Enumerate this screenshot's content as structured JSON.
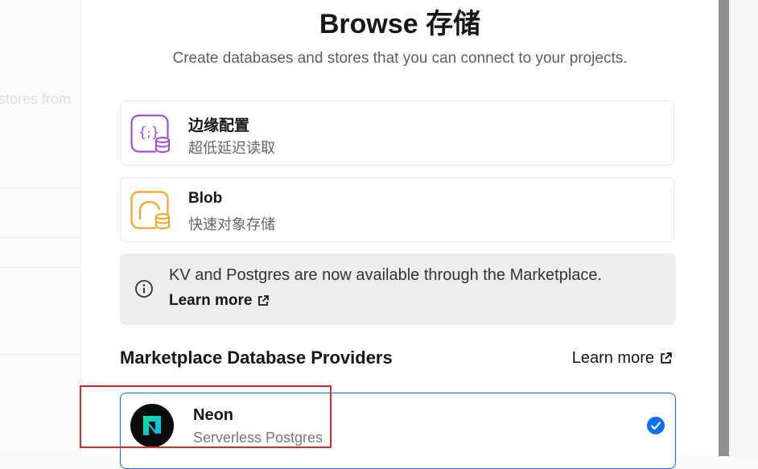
{
  "background": {
    "partial_text": "stores from"
  },
  "modal": {
    "title": "Browse 存储",
    "subtitle": "Create databases and stores that you can connect to your projects."
  },
  "stores": [
    {
      "name": "边缘配置",
      "description": "超低延迟读取",
      "icon": "edge-config-icon",
      "color": "#9b4fd6"
    },
    {
      "name": "Blob",
      "description": "快速对象存储",
      "icon": "blob-icon",
      "color": "#f5a524"
    }
  ],
  "notice": {
    "message": "KV and Postgres are now available through the Marketplace.",
    "link_label": "Learn more",
    "icon": "info-icon"
  },
  "marketplace": {
    "heading": "Marketplace Database Providers",
    "learn_more_label": "Learn more",
    "providers": [
      {
        "name": "Neon",
        "description": "Serverless Postgres",
        "selected": true,
        "icon": "neon-logo",
        "accent": "#0a72ef"
      }
    ]
  },
  "colors": {
    "selection_border": "#0a72ef",
    "highlight": "#d62b2b",
    "neon_gradient_start": "#00e599",
    "neon_gradient_end": "#00b3ff"
  }
}
